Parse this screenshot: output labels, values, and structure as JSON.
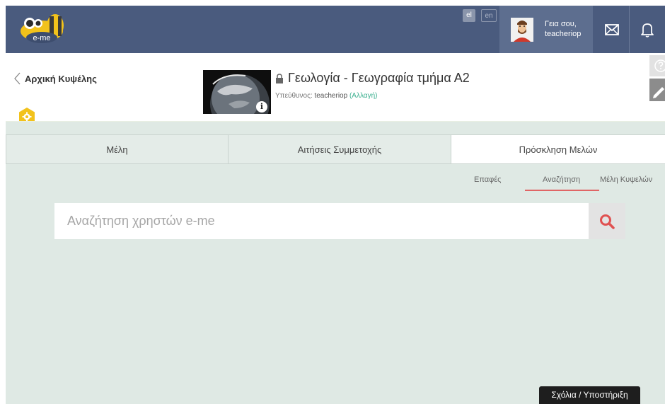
{
  "header": {
    "logo_text": "e-me",
    "lang_el": "el",
    "lang_en": "en",
    "greeting_line1": "Γεια σου,",
    "username": "teacheriop",
    "mail_icon": "mail-icon",
    "bell_icon": "bell-icon"
  },
  "course": {
    "back_label": "Αρχική Κυψέλης",
    "title": "Γεωλογία - Γεωγραφία τμήμα Α2",
    "owner_label": "Υπεύθυνος:",
    "owner_name": "teacheriop",
    "change_label": "(Αλλαγή)",
    "info_badge": "i"
  },
  "tabs": [
    {
      "label": "Μέλη",
      "active": false
    },
    {
      "label": "Αιτήσεις Συμμετοχής",
      "active": false
    },
    {
      "label": "Πρόσκληση Μελών",
      "active": true
    }
  ],
  "subtabs": [
    {
      "label": "Επαφές",
      "active": false
    },
    {
      "label": "Αναζήτηση",
      "active": true
    },
    {
      "label": "Μέλη Κυψελών",
      "active": false
    }
  ],
  "search": {
    "placeholder": "Αναζήτηση χρηστών e-me",
    "value": ""
  },
  "feedback_label": "Σχόλια / Υποστήριξη",
  "colors": {
    "topbar": "#4a5b7e",
    "user_box": "#5d6e8f",
    "panel": "#dfe9e4",
    "accent_red": "#e06565",
    "accent_green": "#3bb08f",
    "hex_yellow": "#f2c21b"
  }
}
